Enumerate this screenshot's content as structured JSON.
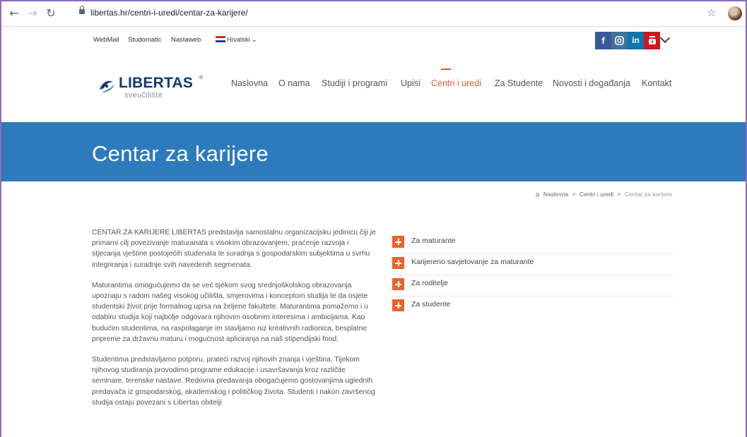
{
  "browser": {
    "url": "libertas.hr/centri-i-uredi/centar-za-karijere/"
  },
  "topbar": {
    "links": [
      "WebMail",
      "Studomatic",
      "Nastaweb"
    ],
    "language": "Hrvatski",
    "social": [
      {
        "name": "facebook-icon",
        "glyph": "f",
        "color": "#3b5998"
      },
      {
        "name": "instagram-icon",
        "glyph": "◘",
        "color": "#3f729b"
      },
      {
        "name": "linkedin-icon",
        "glyph": "in",
        "color": "#0e76a8"
      },
      {
        "name": "youtube-icon",
        "glyph": "▶",
        "color": "#cc181e"
      }
    ]
  },
  "logo": {
    "name": "LIBERTAS",
    "subtitle": "sveučilište",
    "registered": "®"
  },
  "menu": {
    "items": [
      "Naslovna",
      "O nama",
      "Studiji i programi",
      "Upisi",
      "Centri i uredi",
      "Za Studente",
      "Novosti i događanja",
      "Kontakt"
    ],
    "active": "Centri i uredi",
    "active_color": "#e65c2e"
  },
  "banner": {
    "title": "Centar za karijere",
    "color": "#2d7bbd"
  },
  "breadcrumb": {
    "items": [
      "Naslovna",
      "Centri i uredi",
      "Centar za karijere"
    ],
    "separator": ">"
  },
  "content": {
    "paragraphs": [
      "CENTAR ZA KARIJERE LIBERTAS predstavlja samostalnu organizacijsku jedinicu čiji je primarni cilj povezivanje maturanata s visokim obrazovanjem, praćenje razvoja i stjecanja vještine postojećih studenata te suradnja s gospodarskim subjektima u svrhu integriranja i suradnje svih navedenih segmenata.",
      "Maturantima omogućujemo da se već tijekom svog srednjoškolskog obrazovanja upoznaju s radom našeg visokog učilišta, smjerovima i konceptom studija te da osjete studentski život prije formalnog upisa na željene fakultete. Maturantima pomažemo i u odabiru studija koji najbolje odgovara njihovim osobnim interesima i ambicijama. Kao budućim studentima, na raspolaganje im stavljamo niz kreativnih radionica, besplatne pripreme za državnu maturu i mogućnost apliciranja na naš stipendijski fond.",
      "Studentima predstavljamo potporu, prateći razvoj njihovih znanja i vještina. Tijekom njihovog studiranja provodimo programe edukacije i usavršavanja kroz različite seminare, terenske nastave. Redovna predavanja obogaćujemo gostovanjima uglednih predavača iz gospodarskog, akademskog i političkog života. Studenti i nakon završenog studija ostaju povezani s Libertas obitelji"
    ]
  },
  "accordion": {
    "items": [
      "Za maturante",
      "Karijereno savjetovanje za maturante",
      "Za roditelje",
      "Za studente"
    ],
    "accent_color": "#e8642c"
  }
}
